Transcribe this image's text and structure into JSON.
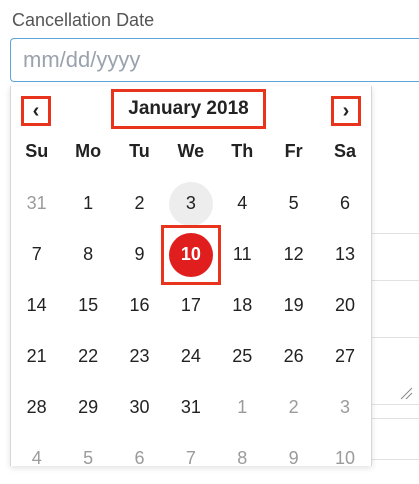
{
  "field": {
    "label": "Cancellation Date",
    "placeholder": "mm/dd/yyyy",
    "value": ""
  },
  "datepicker": {
    "month_label": "January 2018",
    "prev_icon": "‹",
    "next_icon": "›",
    "weekdays": [
      "Su",
      "Mo",
      "Tu",
      "We",
      "Th",
      "Fr",
      "Sa"
    ],
    "weeks": [
      [
        {
          "d": "31",
          "other": true
        },
        {
          "d": "1"
        },
        {
          "d": "2"
        },
        {
          "d": "3",
          "today": true
        },
        {
          "d": "4"
        },
        {
          "d": "5"
        },
        {
          "d": "6"
        }
      ],
      [
        {
          "d": "7"
        },
        {
          "d": "8"
        },
        {
          "d": "9"
        },
        {
          "d": "10",
          "selected": true
        },
        {
          "d": "11"
        },
        {
          "d": "12"
        },
        {
          "d": "13"
        }
      ],
      [
        {
          "d": "14"
        },
        {
          "d": "15"
        },
        {
          "d": "16"
        },
        {
          "d": "17"
        },
        {
          "d": "18"
        },
        {
          "d": "19"
        },
        {
          "d": "20"
        }
      ],
      [
        {
          "d": "21"
        },
        {
          "d": "22"
        },
        {
          "d": "23"
        },
        {
          "d": "24"
        },
        {
          "d": "25"
        },
        {
          "d": "26"
        },
        {
          "d": "27"
        }
      ],
      [
        {
          "d": "28"
        },
        {
          "d": "29"
        },
        {
          "d": "30"
        },
        {
          "d": "31"
        },
        {
          "d": "1",
          "other": true
        },
        {
          "d": "2",
          "other": true
        },
        {
          "d": "3",
          "other": true
        }
      ],
      [
        {
          "d": "4",
          "other": true
        },
        {
          "d": "5",
          "other": true
        },
        {
          "d": "6",
          "other": true
        },
        {
          "d": "7",
          "other": true
        },
        {
          "d": "8",
          "other": true
        },
        {
          "d": "9",
          "other": true
        },
        {
          "d": "10",
          "other": true
        }
      ]
    ]
  },
  "colors": {
    "highlight_box": "#e8341c",
    "selected_fill": "#e01e1e",
    "input_border": "#5aa6d8"
  }
}
